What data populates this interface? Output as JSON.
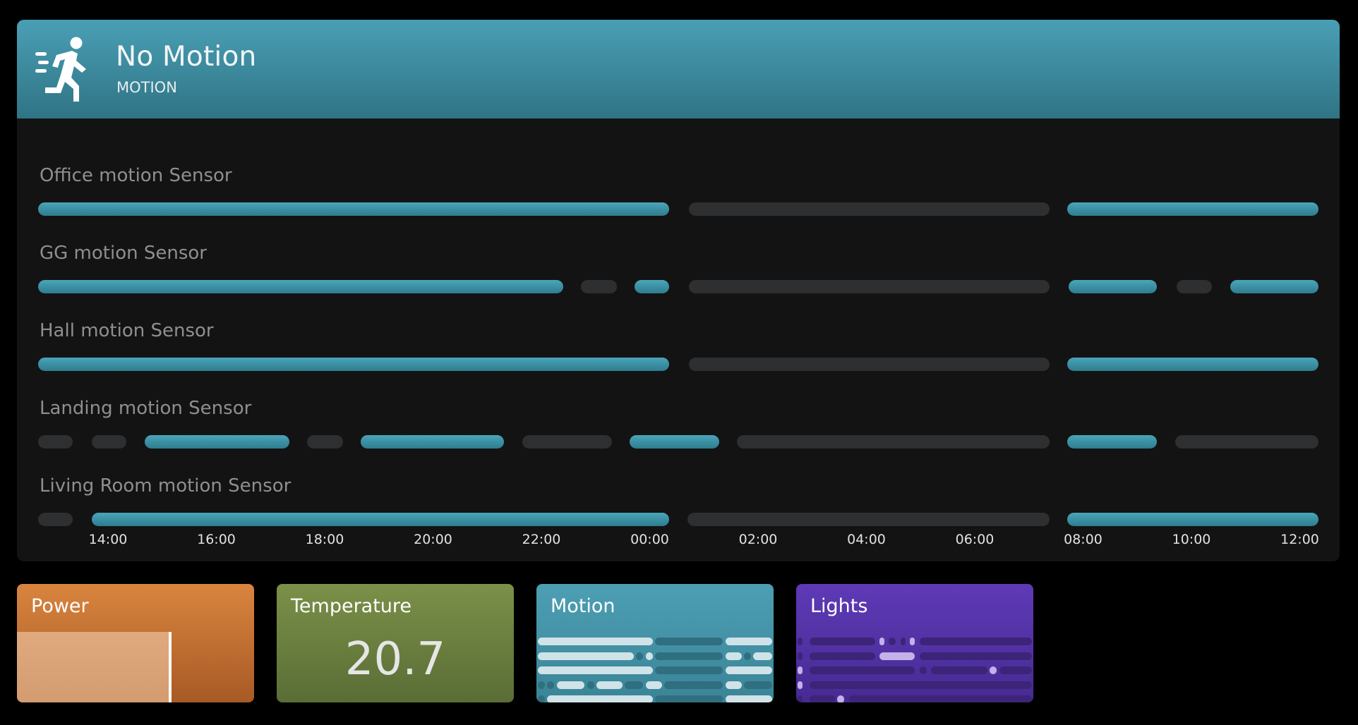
{
  "main_card": {
    "title": "No Motion",
    "subtitle": "MOTION",
    "icon": "running-person-icon",
    "accent_color": "#4a9fb5",
    "sensors": [
      {
        "name": "Office motion Sensor",
        "segments": [
          [
            0,
            0.493,
            1
          ],
          [
            0.508,
            0.79,
            0
          ],
          [
            0.804,
            1,
            1
          ]
        ]
      },
      {
        "name": "GG motion Sensor",
        "segments": [
          [
            0,
            0.41,
            1
          ],
          [
            0.424,
            0.452,
            0
          ],
          [
            0.466,
            0.493,
            1
          ],
          [
            0.508,
            0.79,
            0
          ],
          [
            0.805,
            0.874,
            1
          ],
          [
            0.889,
            0.917,
            0
          ],
          [
            0.931,
            1,
            1
          ]
        ]
      },
      {
        "name": "Hall motion Sensor",
        "segments": [
          [
            0,
            0.493,
            1
          ],
          [
            0.508,
            0.79,
            0
          ],
          [
            0.804,
            1,
            1
          ]
        ]
      },
      {
        "name": "Landing motion Sensor",
        "segments": [
          [
            0,
            0.027,
            0
          ],
          [
            0.042,
            0.069,
            0
          ],
          [
            0.083,
            0.196,
            1
          ],
          [
            0.21,
            0.238,
            0
          ],
          [
            0.252,
            0.364,
            1
          ],
          [
            0.378,
            0.448,
            0
          ],
          [
            0.462,
            0.532,
            1
          ],
          [
            0.546,
            0.79,
            0
          ],
          [
            0.804,
            0.874,
            1
          ],
          [
            0.888,
            1,
            0
          ]
        ]
      },
      {
        "name": "Living Room motion Sensor",
        "segments": [
          [
            0,
            0.027,
            0
          ],
          [
            0.042,
            0.493,
            1
          ],
          [
            0.507,
            0.79,
            0
          ],
          [
            0.804,
            1,
            1
          ]
        ]
      }
    ],
    "axis_ticks": [
      "14:00",
      "16:00",
      "18:00",
      "20:00",
      "22:00",
      "00:00",
      "02:00",
      "04:00",
      "06:00",
      "08:00",
      "10:00",
      "12:00"
    ]
  },
  "tiles": {
    "power": {
      "title": "Power",
      "color": "#d9853f",
      "level": 0.64
    },
    "temperature": {
      "title": "Temperature",
      "value": "20.7",
      "color": "#7b9048"
    },
    "motion": {
      "title": "Motion",
      "color": "#4a9fb5"
    },
    "lights": {
      "title": "Lights",
      "color": "#5e3ab6"
    }
  },
  "mini_motion": [
    [
      [
        0,
        0.49,
        1
      ],
      [
        0.5,
        0.79,
        0
      ],
      [
        0.8,
        1,
        1
      ]
    ],
    [
      [
        0,
        0.41,
        1
      ],
      [
        0.42,
        0.45,
        0
      ],
      [
        0.46,
        0.49,
        1
      ],
      [
        0.5,
        0.79,
        0
      ],
      [
        0.8,
        0.87,
        1
      ],
      [
        0.88,
        0.91,
        0
      ],
      [
        0.92,
        1,
        1
      ]
    ],
    [
      [
        0,
        0.49,
        1
      ],
      [
        0.5,
        0.79,
        0
      ],
      [
        0.8,
        1,
        1
      ]
    ],
    [
      [
        0,
        0.03,
        0
      ],
      [
        0.04,
        0.07,
        0
      ],
      [
        0.08,
        0.2,
        1
      ],
      [
        0.21,
        0.24,
        0
      ],
      [
        0.25,
        0.36,
        1
      ],
      [
        0.37,
        0.45,
        0
      ],
      [
        0.46,
        0.53,
        1
      ],
      [
        0.54,
        0.79,
        0
      ],
      [
        0.8,
        0.87,
        1
      ],
      [
        0.88,
        1,
        0
      ]
    ],
    [
      [
        0,
        0.03,
        0
      ],
      [
        0.04,
        0.49,
        1
      ],
      [
        0.5,
        0.79,
        0
      ],
      [
        0.8,
        1,
        1
      ]
    ]
  ],
  "mini_lights": [
    [
      [
        0,
        0.02,
        0
      ],
      [
        0.05,
        0.33,
        0
      ],
      [
        0.35,
        0.37,
        1
      ],
      [
        0.39,
        0.42,
        0
      ],
      [
        0.44,
        0.46,
        0
      ],
      [
        0.48,
        0.5,
        1
      ],
      [
        0.52,
        1,
        0
      ]
    ],
    [
      [
        0,
        0.02,
        0
      ],
      [
        0.05,
        0.33,
        0
      ],
      [
        0.35,
        0.5,
        1
      ],
      [
        0.52,
        1,
        0
      ]
    ],
    [
      [
        0,
        0.02,
        1
      ],
      [
        0.05,
        0.5,
        0
      ],
      [
        0.52,
        0.55,
        0
      ],
      [
        0.57,
        0.81,
        0
      ],
      [
        0.82,
        0.85,
        1
      ],
      [
        0.86,
        1,
        0
      ]
    ],
    [
      [
        0,
        0.02,
        1
      ],
      [
        0.05,
        1,
        0
      ]
    ],
    [
      [
        0,
        0.02,
        0
      ],
      [
        0.05,
        0.16,
        0
      ],
      [
        0.17,
        0.2,
        1
      ],
      [
        0.22,
        1,
        0
      ]
    ]
  ]
}
